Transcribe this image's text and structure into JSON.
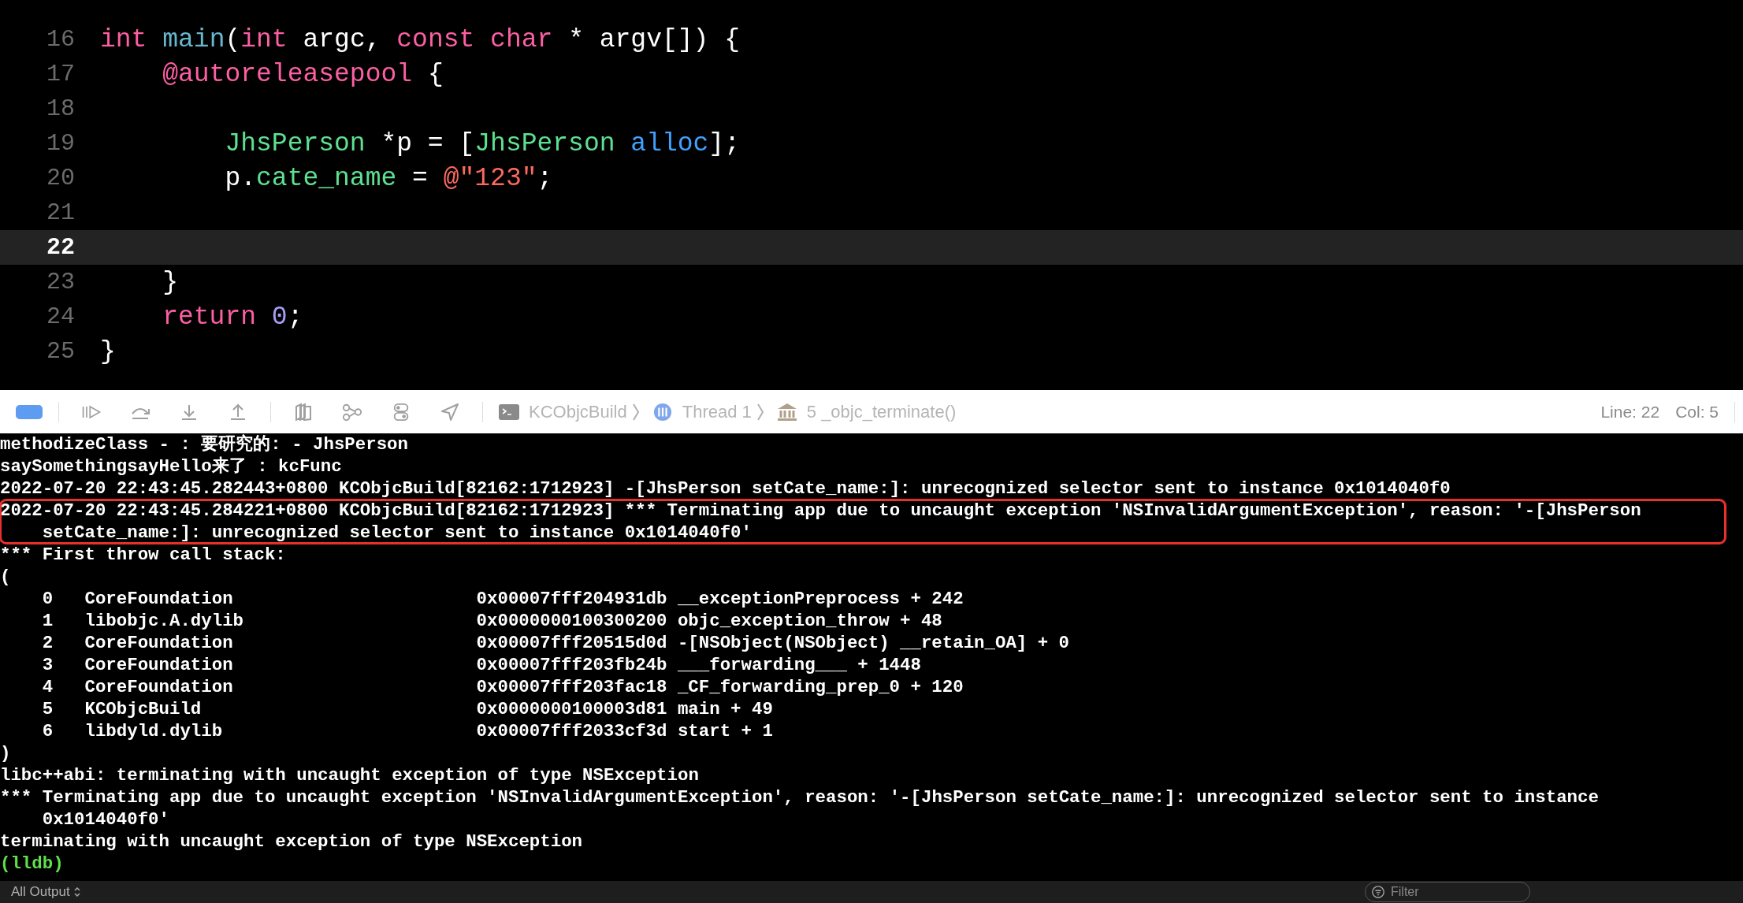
{
  "editor": {
    "lines": [
      {
        "number": "16",
        "current": false,
        "tokens": [
          {
            "kind": "keyword",
            "text": "int "
          },
          {
            "kind": "function",
            "text": "main"
          },
          {
            "kind": "plain",
            "text": "("
          },
          {
            "kind": "keyword",
            "text": "int "
          },
          {
            "kind": "plain",
            "text": "argc, "
          },
          {
            "kind": "keyword",
            "text": "const char "
          },
          {
            "kind": "plain",
            "text": "* argv[]) {"
          }
        ]
      },
      {
        "number": "17",
        "current": false,
        "tokens": [
          {
            "kind": "keyword",
            "text": "    @autoreleasepool"
          },
          {
            "kind": "plain",
            "text": " {"
          }
        ]
      },
      {
        "number": "18",
        "current": false
      },
      {
        "number": "19",
        "current": false,
        "tokens": [
          {
            "kind": "type",
            "text": "        JhsPerson"
          },
          {
            "kind": "plain",
            "text": " *p = ["
          },
          {
            "kind": "type",
            "text": "JhsPerson "
          },
          {
            "kind": "method",
            "text": "alloc"
          },
          {
            "kind": "plain",
            "text": "];"
          }
        ]
      },
      {
        "number": "20",
        "current": false,
        "tokens": [
          {
            "kind": "plain",
            "text": "        p."
          },
          {
            "kind": "property",
            "text": "cate_name"
          },
          {
            "kind": "plain",
            "text": " = "
          },
          {
            "kind": "string",
            "text": "@\"123\""
          },
          {
            "kind": "plain",
            "text": ";"
          }
        ]
      },
      {
        "number": "21",
        "current": false
      },
      {
        "number": "22",
        "current": true
      },
      {
        "number": "23",
        "current": false,
        "tokens": [
          {
            "kind": "plain",
            "text": "    }"
          }
        ]
      },
      {
        "number": "24",
        "current": false,
        "tokens": [
          {
            "kind": "keyword",
            "text": "    return "
          },
          {
            "kind": "number",
            "text": "0"
          },
          {
            "kind": "plain",
            "text": ";"
          }
        ]
      },
      {
        "number": "25",
        "current": false,
        "tokens": [
          {
            "kind": "plain",
            "text": "}"
          }
        ]
      }
    ]
  },
  "debug_bar": {
    "breakpoints_active": true,
    "breadcrumb": [
      "KCObjcBuild",
      "Thread 1",
      "5 _objc_terminate()"
    ],
    "line": "Line: 22",
    "column": "Col: 5"
  },
  "console": {
    "lines": [
      {
        "kind": "text",
        "highlighted": false,
        "text": "methodizeClass - : 要研究的: - JhsPerson"
      },
      {
        "kind": "text",
        "highlighted": false,
        "text": "saySomethingsayHello来了 : kcFunc"
      },
      {
        "kind": "text",
        "highlighted": false,
        "text": "2022-07-20 22:43:45.282443+0800 KCObjcBuild[82162:1712923] -[JhsPerson setCate_name:]: unrecognized selector sent to instance 0x1014040f0"
      },
      {
        "kind": "text",
        "highlighted": true,
        "text": "2022-07-20 22:43:45.284221+0800 KCObjcBuild[82162:1712923] *** Terminating app due to uncaught exception 'NSInvalidArgumentException', reason: '-[JhsPerson setCate_name:]: unrecognized selector sent to instance 0x1014040f0'"
      },
      {
        "kind": "text",
        "highlighted": false,
        "text": "*** First throw call stack:"
      },
      {
        "kind": "text",
        "highlighted": false,
        "text": "("
      },
      {
        "kind": "frame",
        "highlighted": false,
        "index": "0",
        "library": "CoreFoundation",
        "address": "0x00007fff204931db",
        "symbol": "__exceptionPreprocess + 242"
      },
      {
        "kind": "frame",
        "highlighted": false,
        "index": "1",
        "library": "libobjc.A.dylib",
        "address": "0x0000000100300200",
        "symbol": "objc_exception_throw + 48"
      },
      {
        "kind": "frame",
        "highlighted": false,
        "index": "2",
        "library": "CoreFoundation",
        "address": "0x00007fff20515d0d",
        "symbol": "-[NSObject(NSObject) __retain_OA] + 0"
      },
      {
        "kind": "frame",
        "highlighted": false,
        "index": "3",
        "library": "CoreFoundation",
        "address": "0x00007fff203fb24b",
        "symbol": "___forwarding___ + 1448"
      },
      {
        "kind": "frame",
        "highlighted": false,
        "index": "4",
        "library": "CoreFoundation",
        "address": "0x00007fff203fac18",
        "symbol": "_CF_forwarding_prep_0 + 120"
      },
      {
        "kind": "frame",
        "highlighted": false,
        "index": "5",
        "library": "KCObjcBuild",
        "address": "0x0000000100003d81",
        "symbol": "main + 49"
      },
      {
        "kind": "frame",
        "highlighted": false,
        "index": "6",
        "library": "libdyld.dylib",
        "address": "0x00007fff2033cf3d",
        "symbol": "start + 1"
      },
      {
        "kind": "text",
        "highlighted": false,
        "text": ")"
      },
      {
        "kind": "text",
        "highlighted": false,
        "text": "libc++abi: terminating with uncaught exception of type NSException"
      },
      {
        "kind": "text",
        "highlighted": false,
        "text": "*** Terminating app due to uncaught exception 'NSInvalidArgumentException', reason: '-[JhsPerson setCate_name:]: unrecognized selector sent to instance 0x1014040f0'"
      },
      {
        "kind": "text",
        "highlighted": false,
        "text": "terminating with uncaught exception of type NSException"
      },
      {
        "kind": "prompt",
        "highlighted": false,
        "text": "(lldb)"
      }
    ]
  },
  "bottom_bar": {
    "output_menu": "All Output",
    "filter": {
      "placeholder": "Filter"
    }
  }
}
